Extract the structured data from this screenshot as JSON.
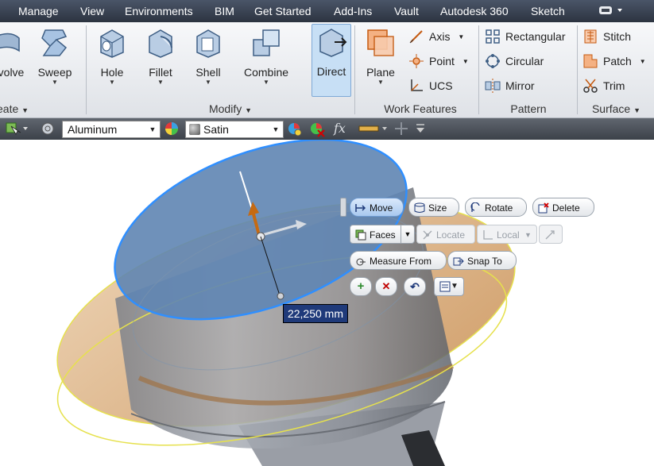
{
  "menu": {
    "items": [
      "Manage",
      "View",
      "Environments",
      "BIM",
      "Get Started",
      "Add-Ins",
      "Vault",
      "Autodesk 360",
      "Sketch"
    ]
  },
  "ribbon": {
    "create": {
      "revolve_label": "volve",
      "sweep_label": "Sweep",
      "panel_title": "eate"
    },
    "modify": {
      "hole_label": "Hole",
      "fillet_label": "Fillet",
      "shell_label": "Shell",
      "combine_label": "Combine",
      "direct_label": "Direct",
      "panel_title": "Modify"
    },
    "work_features": {
      "plane_label": "Plane",
      "axis_label": "Axis",
      "point_label": "Point",
      "ucs_label": "UCS",
      "panel_title": "Work Features"
    },
    "pattern": {
      "rectangular_label": "Rectangular",
      "circular_label": "Circular",
      "mirror_label": "Mirror",
      "panel_title": "Pattern"
    },
    "surface": {
      "stitch_label": "Stitch",
      "patch_label": "Patch",
      "trim_label": "Trim",
      "panel_title": "Surface"
    }
  },
  "propbar": {
    "material": "Aluminum",
    "appearance": "Satin",
    "fx_label": "fx"
  },
  "minitoolbar": {
    "move": "Move",
    "size": "Size",
    "rotate": "Rotate",
    "delete": "Delete",
    "faces": "Faces",
    "locate": "Locate",
    "local": "Local",
    "measure_from": "Measure From",
    "snap_to": "Snap To"
  },
  "dimension": {
    "value": "22,250 mm"
  },
  "colors": {
    "top_face": "#5f85b2",
    "selection_edge": "#2f8fff",
    "preview": "#d9a86c",
    "active_button": "#c7dff5"
  }
}
